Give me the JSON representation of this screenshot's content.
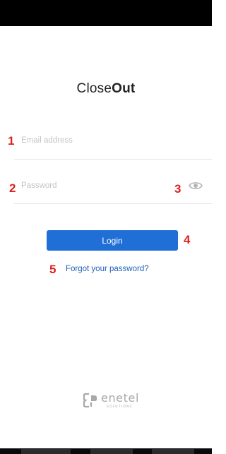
{
  "app": {
    "logo_regular": "Close",
    "logo_bold": "Out"
  },
  "login_form": {
    "email_placeholder": "Email address",
    "password_placeholder": "Password",
    "show_password_icon": "eye-icon",
    "login_label": "Login",
    "forgot_label": "Forgot your password?"
  },
  "annotations": [
    "1",
    "2",
    "3",
    "4",
    "5"
  ],
  "branding": {
    "name": "enetel",
    "tagline": "SOLUTIONS",
    "icon": "enetel-logo-icon"
  },
  "colors": {
    "primary": "#1f6fd6",
    "link": "#1f5fb8",
    "annotation": "#e02020"
  }
}
